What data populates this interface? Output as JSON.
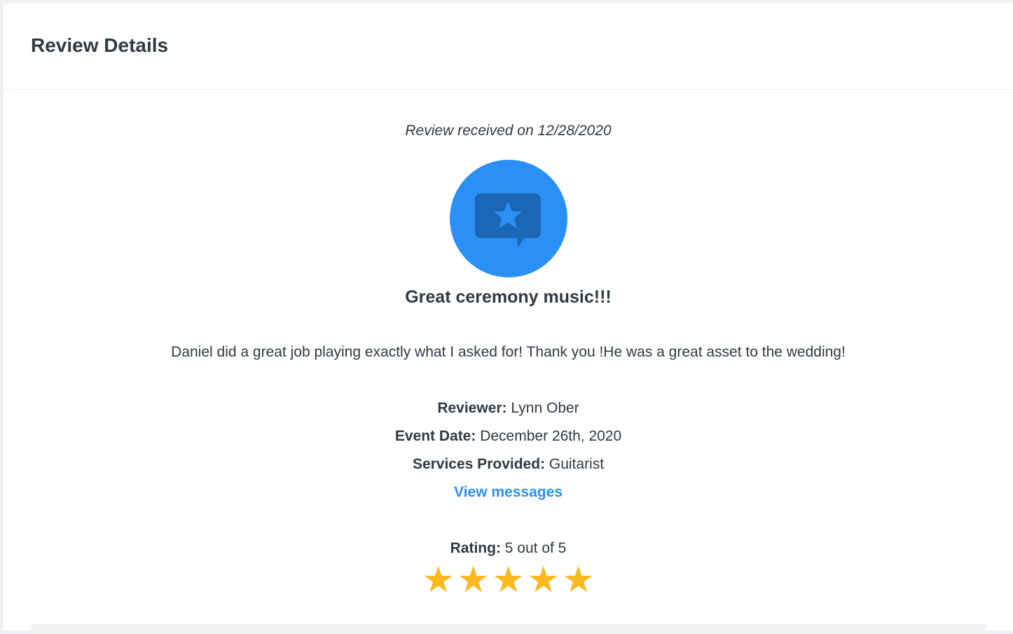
{
  "header": {
    "title": "Review Details"
  },
  "review": {
    "received_label": "Review received on 12/28/2020",
    "badge_icon": "review-star-bubble-icon",
    "title": "Great ceremony music!!!",
    "text": "Daniel did a great job playing exactly what I asked for! Thank you !He was a great asset to the wedding!",
    "reviewer_label": "Reviewer:",
    "reviewer_value": "Lynn Ober",
    "event_date_label": "Event Date:",
    "event_date_value": "December 26th, 2020",
    "services_label": "Services Provided:",
    "services_value": "Guitarist",
    "view_messages_label": "View messages",
    "rating_label": "Rating:",
    "rating_value": "5 out of 5",
    "rating": 5,
    "rating_max": 5,
    "star_glyph": "★"
  },
  "colors": {
    "accent": "#2b90f6",
    "badge_inner": "#1c66b6",
    "star": "#fbb91f",
    "text": "#2f3a44"
  }
}
